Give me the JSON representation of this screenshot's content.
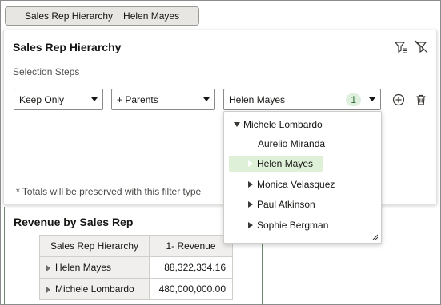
{
  "breadcrumb": {
    "hierarchy": "Sales Rep Hierarchy",
    "member": "Helen Mayes"
  },
  "filter_panel": {
    "title": "Sales Rep Hierarchy",
    "filter_icon": "filter-icon",
    "clear_filter_icon": "clear-filter-icon",
    "steps_label": "Selection Steps",
    "step_action": "Keep Only",
    "step_relation": "+ Parents",
    "step_members": "Helen Mayes",
    "step_count": "1",
    "add_icon": "add-circle-icon",
    "delete_icon": "trash-icon",
    "totals_note": "* Totals will be preserved with this filter type"
  },
  "dropdown": {
    "tree": [
      {
        "label": "Michele Lombardo",
        "state": "expanded"
      },
      {
        "label": "Aurelio Miranda",
        "state": "leaf"
      },
      {
        "label": "Helen Mayes",
        "state": "selected"
      },
      {
        "label": "Monica Velasquez",
        "state": "collapsed"
      },
      {
        "label": "Paul Atkinson",
        "state": "collapsed"
      },
      {
        "label": "Sophie Bergman",
        "state": "collapsed"
      }
    ]
  },
  "report": {
    "title": "Revenue by Sales Rep",
    "columns": [
      "Sales Rep Hierarchy",
      "1- Revenue"
    ],
    "rows": [
      {
        "name": "Helen Mayes",
        "value": "88,322,334.16"
      },
      {
        "name": "Michele Lombardo",
        "value": "480,000,000.00"
      }
    ]
  },
  "colors": {
    "selected_bg": "#dff0d8",
    "badge_bg": "#dff0df",
    "header_bg": "#f1efed"
  }
}
